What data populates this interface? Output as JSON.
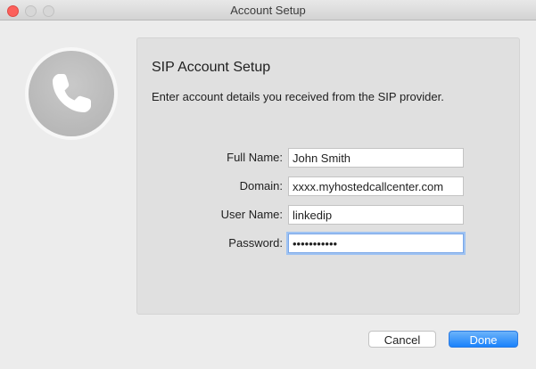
{
  "window": {
    "title": "Account Setup"
  },
  "panel": {
    "heading": "SIP Account Setup",
    "description": "Enter account details you received from the SIP provider."
  },
  "form": {
    "full_name": {
      "label": "Full Name:",
      "value": "John Smith"
    },
    "domain": {
      "label": "Domain:",
      "value": "xxxx.myhostedcallcenter.com"
    },
    "user_name": {
      "label": "User Name:",
      "value": "linkedip"
    },
    "password": {
      "label": "Password:",
      "value": "•••••••••••"
    }
  },
  "buttons": {
    "cancel": "Cancel",
    "done": "Done"
  },
  "icons": {
    "close": "close-icon",
    "minimize": "minimize-icon",
    "zoom": "zoom-icon",
    "phone": "phone-icon"
  },
  "colors": {
    "accent": "#1a82fb",
    "close": "#fc605b"
  }
}
